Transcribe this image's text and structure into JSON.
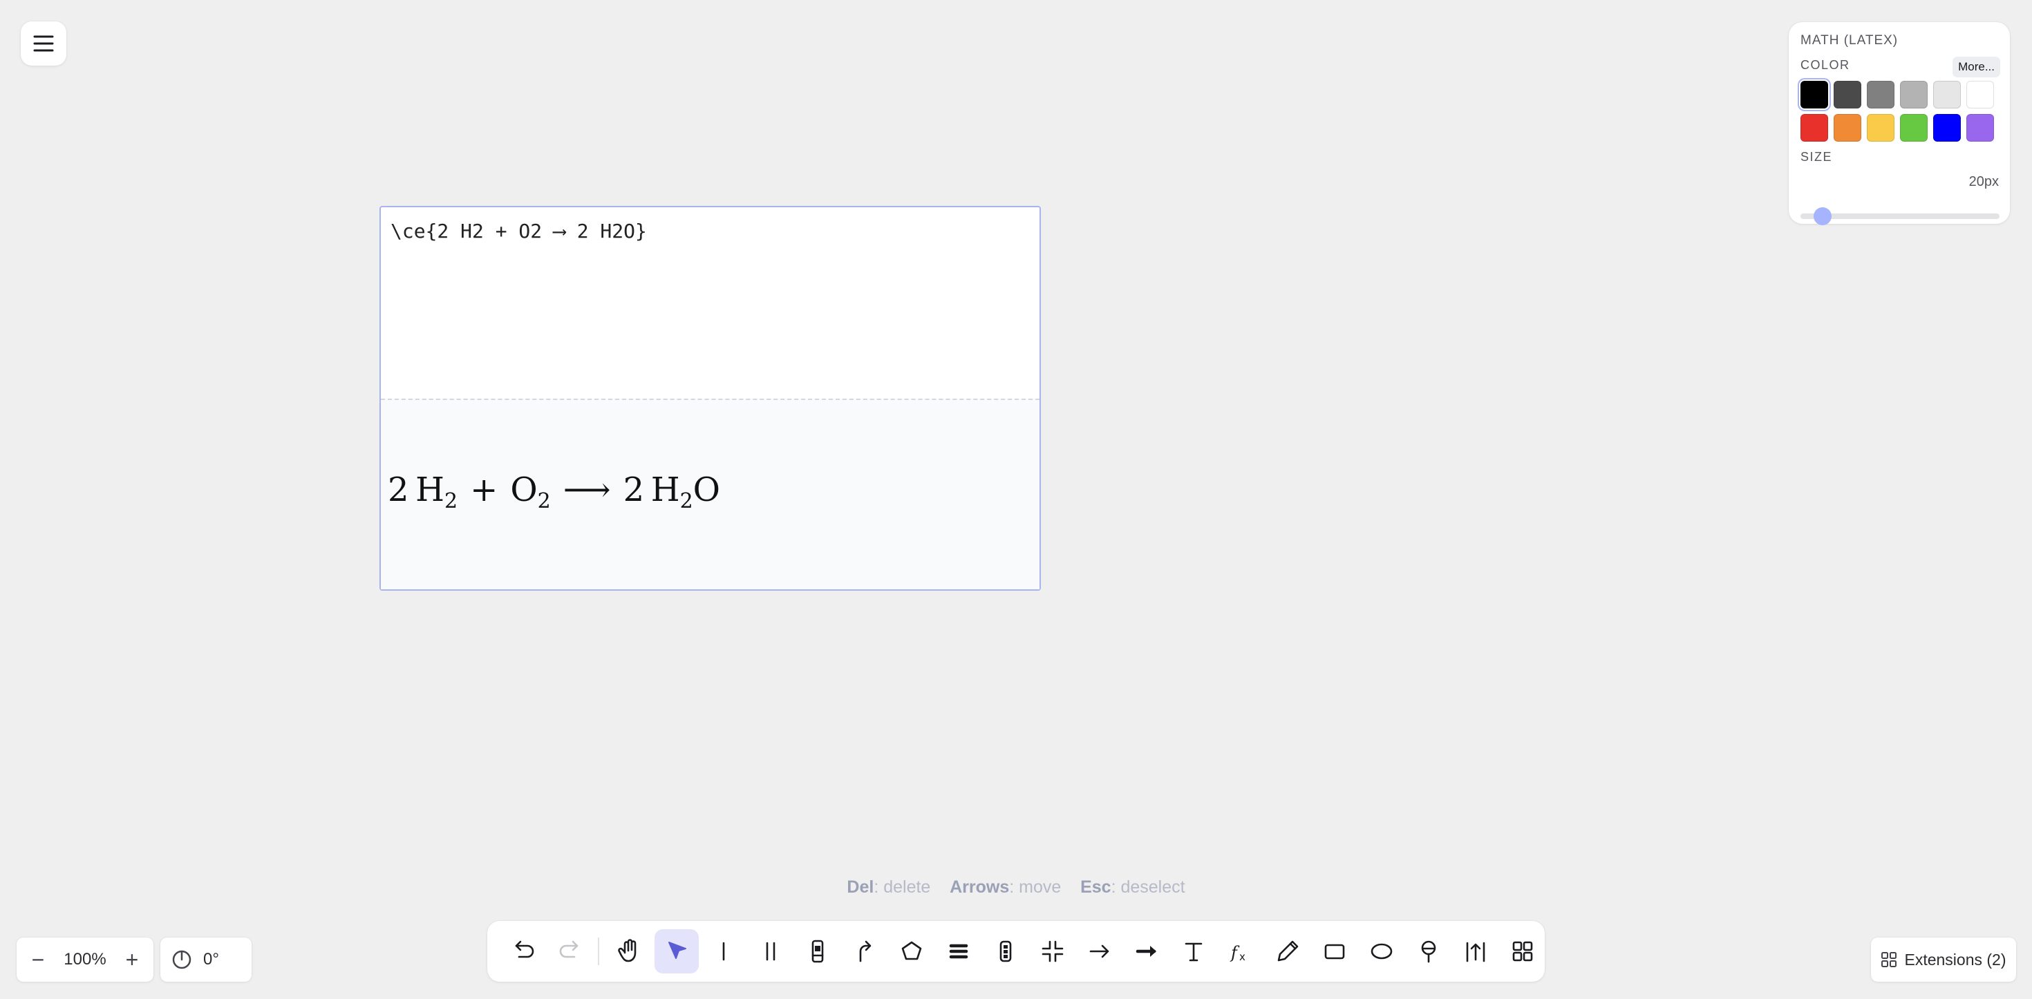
{
  "panel": {
    "title": "MATH (LATEX)",
    "color_label": "COLOR",
    "more_label": "More...",
    "size_label": "SIZE",
    "size_value": "20px",
    "size_slider_fraction": 0.11,
    "colors": [
      "#000000",
      "#4a4a4a",
      "#808080",
      "#b3b3b3",
      "#e6e6e6",
      "#ffffff",
      "#e8312a",
      "#f08a35",
      "#f9cb48",
      "#67c942",
      "#0000ff",
      "#9966ee"
    ],
    "selected_color": "#000000"
  },
  "math": {
    "source": "\\ce{2 H2 + O2 ⟶ 2 H2O}",
    "rendered": {
      "c1": "2",
      "h": "H",
      "sub2a": "2",
      "plus": "+",
      "o": "O",
      "sub2b": "2",
      "arrow": "⟶",
      "c2": "2",
      "h2": "H",
      "sub2c": "2",
      "o2": "O"
    }
  },
  "hints": {
    "del_key": "Del",
    "del_text": ": delete",
    "arrows_key": "Arrows",
    "arrows_text": ": move",
    "esc_key": "Esc",
    "esc_text": ": deselect"
  },
  "zoom": {
    "minus": "−",
    "value": "100%",
    "plus": "+"
  },
  "rotation": {
    "value": "0°"
  },
  "extensions": {
    "label": "Extensions (2)"
  },
  "toolbar": {
    "tools": [
      "undo-icon",
      "redo-icon",
      "hand-icon",
      "select-pointer-icon",
      "single-line-icon",
      "double-line-icon",
      "device-icon",
      "curved-arrow-icon",
      "pentagon-icon",
      "stack-icon",
      "battery-icon",
      "compress-icon",
      "arrow-icon",
      "bold-arrow-icon",
      "text-icon",
      "function-icon",
      "pencil-icon",
      "rectangle-icon",
      "ellipse-icon",
      "pin-icon",
      "vector-up-icon",
      "grid-icon"
    ],
    "active_tool": "select-pointer-icon",
    "accent": "#5b5bd6"
  }
}
